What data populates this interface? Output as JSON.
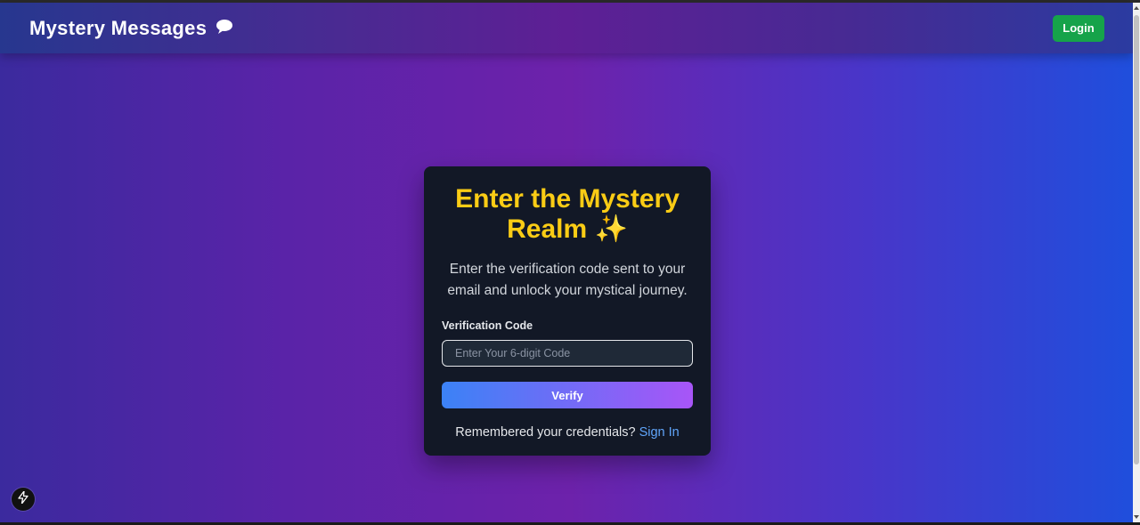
{
  "navbar": {
    "brand": "Mystery Messages",
    "brand_icon": "speech-bubble-icon",
    "login_label": "Login"
  },
  "card": {
    "title": "Enter the Mystery Realm ✨",
    "subtitle": "Enter the verification code sent to your email and unlock your mystical journey.",
    "field_label": "Verification Code",
    "input_placeholder": "Enter Your 6-digit Code",
    "input_value": "",
    "verify_label": "Verify",
    "footer_text": "Remembered your credentials?",
    "signin_label": "Sign In"
  },
  "dev_badge_icon": "lightning-bolt-icon",
  "colors": {
    "title": "#facc15",
    "login_button": "#16a34a",
    "link": "#60a5fa",
    "verify_gradient_start": "#3b82f6",
    "verify_gradient_end": "#a855f7"
  }
}
